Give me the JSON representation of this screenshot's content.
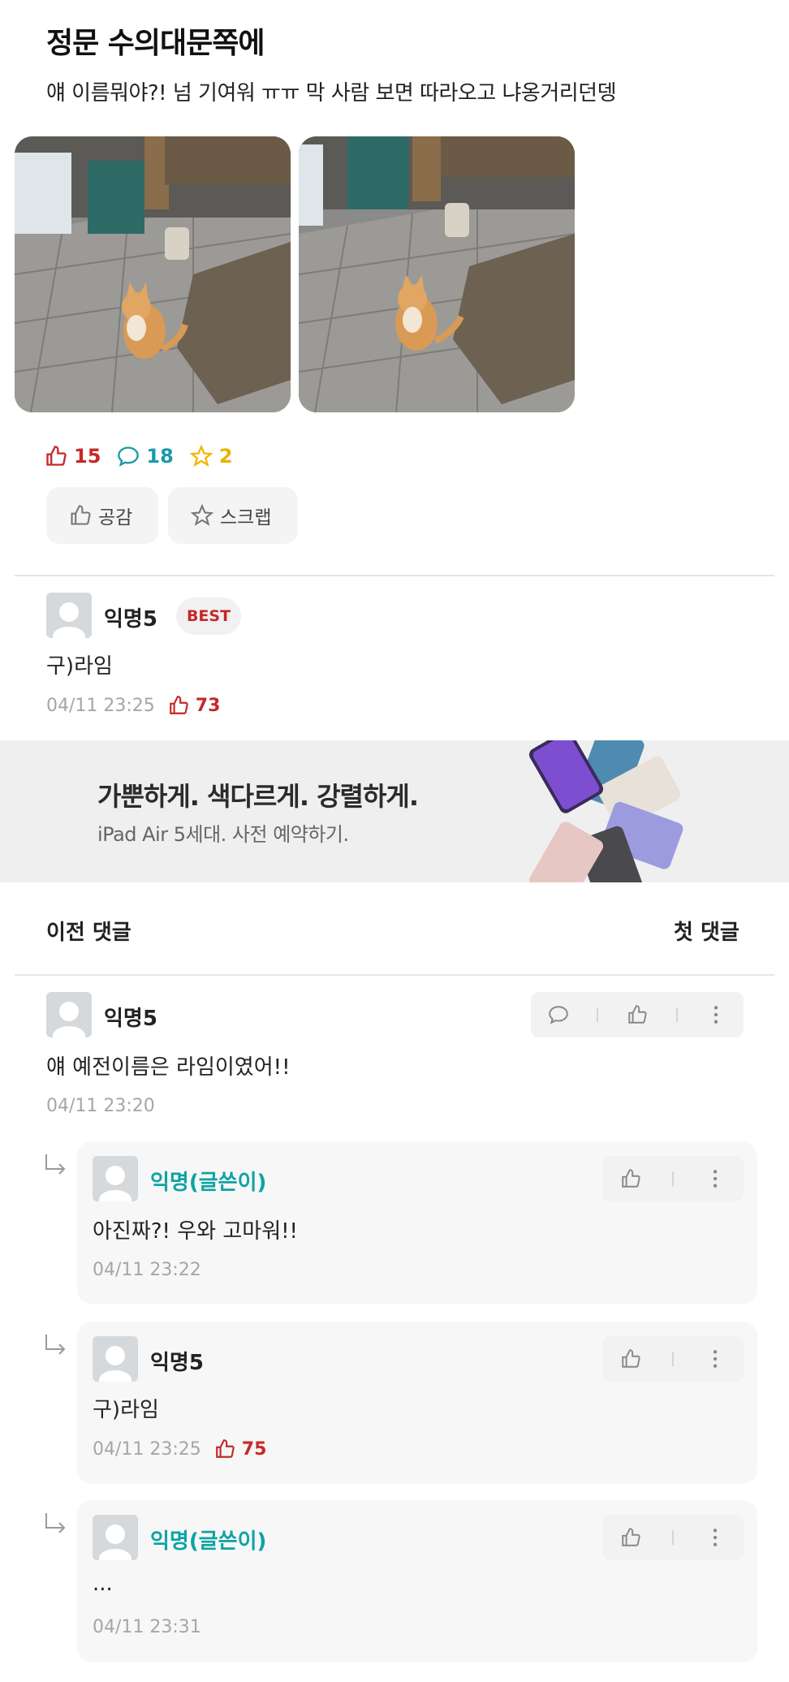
{
  "post": {
    "title": "정문 수의대문쪽에",
    "body": "얘 이름뭐야?! 넘 기여워 ㅠㅠ 막 사람 보면 따라오고 냐옹거리던뎅",
    "stats": {
      "likes": "15",
      "comments": "18",
      "scraps": "2"
    },
    "actions": {
      "like_label": "공감",
      "scrap_label": "스크랩"
    }
  },
  "colors": {
    "like_red": "#c62828",
    "comment_teal": "#1a9aa8",
    "scrap_yellow": "#f2b705",
    "op_teal": "#0fa3a3"
  },
  "best_comment": {
    "author": "익명5",
    "badge": "BEST",
    "text": "구)라임",
    "time": "04/11 23:25",
    "likes": "73"
  },
  "ad": {
    "headline": "가뿐하게. 색다르게. 강렬하게.",
    "subline": "iPad Air 5세대. 사전 예약하기."
  },
  "nav": {
    "prev_label": "이전 댓글",
    "first_label": "첫 댓글"
  },
  "comments": [
    {
      "author": "익명5",
      "text": "얘 예전이름은 라임이였어!!",
      "time": "04/11 23:20"
    }
  ],
  "replies": [
    {
      "author": "익명(글쓴이)",
      "text": "아진짜?! 우와 고마워!!",
      "time": "04/11 23:22",
      "likes": ""
    },
    {
      "author": "익명5",
      "text": "구)라임",
      "time": "04/11 23:25",
      "likes": "75"
    },
    {
      "author": "익명(글쓴이)",
      "text": "...",
      "time": "04/11 23:31",
      "likes": ""
    }
  ],
  "icons": {
    "like": "thumbs-up-icon",
    "comment": "speech-bubble-icon",
    "scrap": "star-icon",
    "more": "kebab-menu-icon",
    "reply_arrow": "reply-arrow-icon"
  }
}
